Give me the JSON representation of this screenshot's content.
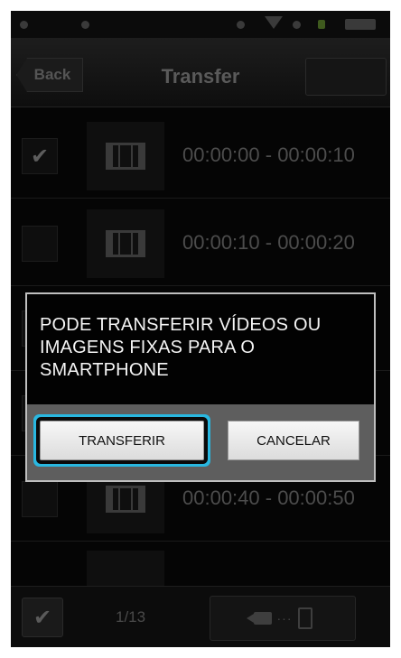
{
  "header": {
    "back_label": "Back",
    "title": "Transfer"
  },
  "list": [
    {
      "checked": true,
      "check_glyph": "✔",
      "time_range": "00:00:00 - 00:00:10"
    },
    {
      "checked": false,
      "check_glyph": "",
      "time_range": "00:00:10 - 00:00:20"
    },
    {
      "checked": false,
      "check_glyph": "",
      "time_range": "00:00:40 - 00:00:50"
    }
  ],
  "dialog": {
    "message": "PODE TRANSFERIR VÍDEOS OU IMAGENS FIXAS PARA O SMARTPHONE",
    "transfer_label": "TRANSFERIR",
    "cancel_label": "CANCELAR",
    "focus_color": "#29b7e0"
  },
  "footer": {
    "check_glyph": "✔",
    "page_count": "1/13"
  },
  "icons": {
    "list_thumbnail": "film-icon",
    "footer_transfer": "camera-to-phone-icon"
  }
}
